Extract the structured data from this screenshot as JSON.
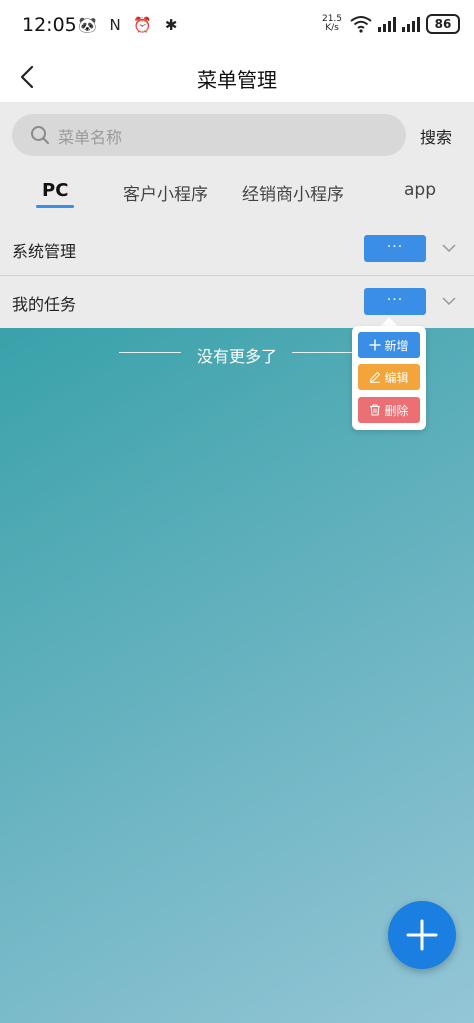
{
  "status_bar": {
    "time": "12:05",
    "left_icons": "🐼 N ⏰ ✱",
    "net_speed_value": "21.5",
    "net_speed_unit": "K/s",
    "battery": "86"
  },
  "navbar": {
    "title": "菜单管理"
  },
  "search": {
    "placeholder": "菜单名称",
    "button_label": "搜索"
  },
  "tabs": [
    {
      "label": "PC",
      "active": true
    },
    {
      "label": "客户小程序",
      "active": false
    },
    {
      "label": "经销商小程序",
      "active": false
    },
    {
      "label": "app",
      "active": false
    }
  ],
  "menu_items": [
    {
      "label": "系统管理",
      "more_label": "···"
    },
    {
      "label": "我的任务",
      "more_label": "···"
    }
  ],
  "popup_menu": {
    "add_label": "新增",
    "edit_label": "编辑",
    "delete_label": "删除"
  },
  "list_footer": {
    "text": "没有更多了"
  },
  "colors": {
    "primary": "#3a8ee6",
    "warning": "#f3a43b",
    "danger": "#eb6f73",
    "fab": "#1a7fe0"
  },
  "icons": {
    "back": "chevron-left-icon",
    "search": "search-icon",
    "expand": "chevron-down-icon",
    "add": "plus-icon",
    "edit": "pencil-icon",
    "delete": "trash-icon"
  }
}
